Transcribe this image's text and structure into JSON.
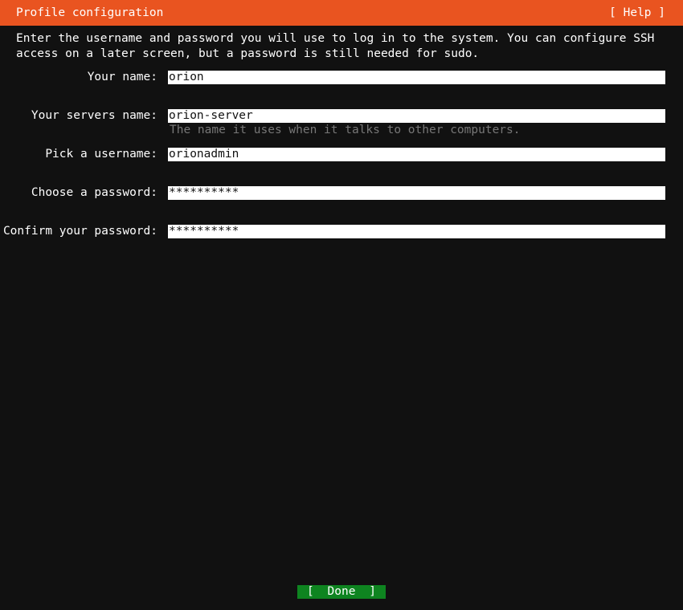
{
  "header": {
    "title": "Profile configuration",
    "help_label": "[ Help ]"
  },
  "intro": {
    "text": "Enter the username and password you will use to log in to the system. You can configure SSH access on a later screen, but a password is still needed for sudo."
  },
  "form": {
    "fields": [
      {
        "label": "Your name:",
        "value": "orion",
        "hint": ""
      },
      {
        "label": "Your servers name:",
        "value": "orion-server",
        "hint": "The name it uses when it talks to other computers."
      },
      {
        "label": "Pick a username:",
        "value": "orionadmin",
        "hint": ""
      },
      {
        "label": "Choose a password:",
        "value": "**********",
        "hint": ""
      },
      {
        "label": "Confirm your password:",
        "value": "**********",
        "hint": ""
      }
    ]
  },
  "footer": {
    "done_left_bracket": "[",
    "done_label": "Done",
    "done_right_bracket": "]"
  },
  "colors": {
    "header_background": "#e95420",
    "screen_background": "#111111",
    "input_background": "#ffffff",
    "input_text": "#111111",
    "hint_text": "#777777",
    "button_background": "#0e8420",
    "text": "#ffffff"
  }
}
